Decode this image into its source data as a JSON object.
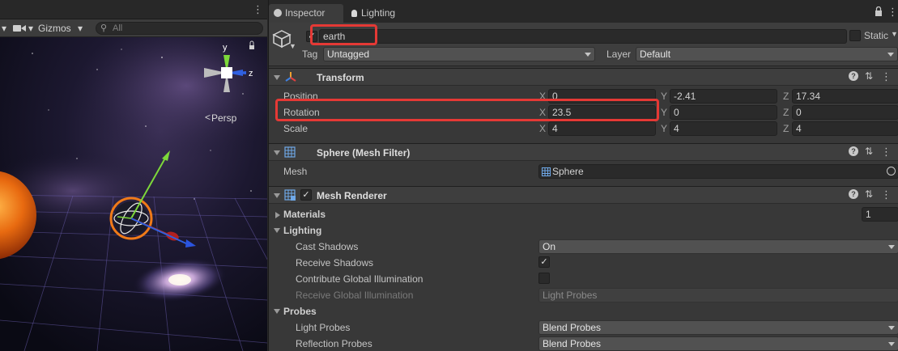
{
  "scene": {
    "gizmos_label": "Gizmos",
    "search_placeholder": "All",
    "persp_label": "Persp",
    "axis_y": "y",
    "axis_z": "z"
  },
  "tabs": [
    {
      "label": "Inspector"
    },
    {
      "label": "Lighting"
    }
  ],
  "object": {
    "name": "earth",
    "static_label": "Static",
    "tag_label": "Tag",
    "tag_value": "Untagged",
    "layer_label": "Layer",
    "layer_value": "Default"
  },
  "transform": {
    "title": "Transform",
    "rows": [
      {
        "label": "Position",
        "x": "0",
        "y": "-2.41",
        "z": "17.34"
      },
      {
        "label": "Rotation",
        "x": "23.5",
        "y": "0",
        "z": "0"
      },
      {
        "label": "Scale",
        "x": "4",
        "y": "4",
        "z": "4"
      }
    ],
    "axis_labels": {
      "x": "X",
      "y": "Y",
      "z": "Z"
    }
  },
  "mesh_filter": {
    "title": "Sphere (Mesh Filter)",
    "mesh_label": "Mesh",
    "mesh_value": "Sphere"
  },
  "mesh_renderer": {
    "title": "Mesh Renderer",
    "materials_label": "Materials",
    "materials_count": "1",
    "lighting_label": "Lighting",
    "cast_shadows_label": "Cast Shadows",
    "cast_shadows_value": "On",
    "receive_shadows_label": "Receive Shadows",
    "contribute_gi_label": "Contribute Global Illumination",
    "receive_gi_label": "Receive Global Illumination",
    "receive_gi_value": "Light Probes",
    "probes_label": "Probes",
    "light_probes_label": "Light Probes",
    "light_probes_value": "Blend Probes",
    "reflection_probes_label": "Reflection Probes",
    "reflection_probes_value": "Blend Probes"
  },
  "colors": {
    "highlight_red": "#e53935",
    "panel_bg": "#383838",
    "field_bg": "#2a2a2a"
  }
}
